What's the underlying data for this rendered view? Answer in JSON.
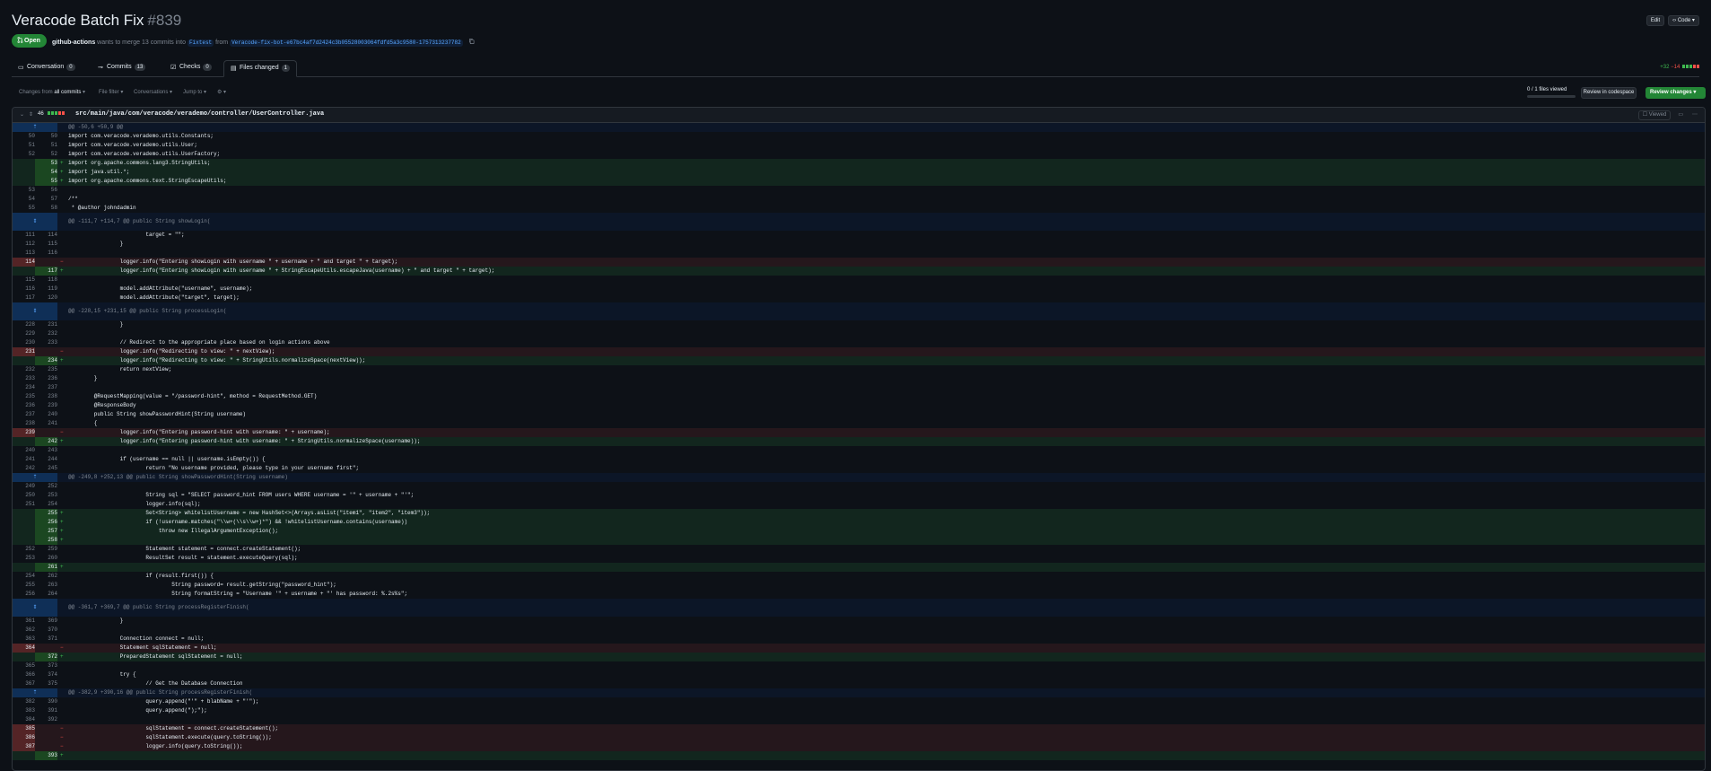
{
  "pr": {
    "title": "Veracode Batch Fix",
    "number": "#839",
    "state": "Open",
    "author": "github-actions",
    "merge_text": "wants to merge 13 commits into",
    "base_branch": "Fixtest",
    "from_text": "from",
    "head_branch": "Veracode-fix-bot-e67bc4af7d2424c3b05528003064fdfd5a3c9580-1757313237782",
    "edit_label": "Edit",
    "code_label": "Code"
  },
  "tabs": [
    {
      "label": "Conversation",
      "count": "0"
    },
    {
      "label": "Commits",
      "count": "13"
    },
    {
      "label": "Checks",
      "count": "0"
    },
    {
      "label": "Files changed",
      "count": "1"
    }
  ],
  "diffstat": {
    "additions": "+32",
    "deletions": "−14"
  },
  "toolbar": {
    "changes_from": "Changes from",
    "all_commits": "all commits",
    "file_filter": "File filter",
    "conversations": "Conversations",
    "jump_to": "Jump to",
    "files_viewed": "0 / 1 files viewed",
    "review_codespace": "Review in codespace",
    "review_changes": "Review changes"
  },
  "file": {
    "changes": "46",
    "path": "src/main/java/com/veracode/verademo/controller/UserController.java",
    "viewed_label": "Viewed"
  },
  "diff_lines": [
    {
      "t": "hunk",
      "o": "",
      "n": "",
      "c": "@@ -50,6 +50,9 @@"
    },
    {
      "t": "ctx",
      "o": "50",
      "n": "50",
      "c": "import com.veracode.verademo.utils.Constants;"
    },
    {
      "t": "ctx",
      "o": "51",
      "n": "51",
      "c": "import com.veracode.verademo.utils.User;"
    },
    {
      "t": "ctx",
      "o": "52",
      "n": "52",
      "c": "import com.veracode.verademo.utils.UserFactory;"
    },
    {
      "t": "add",
      "o": "",
      "n": "53",
      "c": "import org.apache.commons.lang3.StringUtils;"
    },
    {
      "t": "add",
      "o": "",
      "n": "54",
      "c": "import java.util.*;"
    },
    {
      "t": "add",
      "o": "",
      "n": "55",
      "c": "import org.apache.commons.text.StringEscapeUtils;"
    },
    {
      "t": "ctx",
      "o": "53",
      "n": "56",
      "c": ""
    },
    {
      "t": "ctx",
      "o": "54",
      "n": "57",
      "c": "/**"
    },
    {
      "t": "ctx",
      "o": "55",
      "n": "58",
      "c": " * @author johndadmin"
    },
    {
      "t": "hunkT",
      "o": "",
      "n": "",
      "c": "@@ -111,7 +114,7 @@ public String showLogin("
    },
    {
      "t": "ctx",
      "o": "111",
      "n": "114",
      "c": "                        target = \"\";"
    },
    {
      "t": "ctx",
      "o": "112",
      "n": "115",
      "c": "                }"
    },
    {
      "t": "ctx",
      "o": "113",
      "n": "116",
      "c": ""
    },
    {
      "t": "del",
      "o": "114",
      "n": "",
      "c": "                logger.info(\"Entering showLogin with username \" + username + \" and target \" + target);"
    },
    {
      "t": "add",
      "o": "",
      "n": "117",
      "c": "                logger.info(\"Entering showLogin with username \" + StringEscapeUtils.escapeJava(username) + \" and target \" + target);"
    },
    {
      "t": "ctx",
      "o": "115",
      "n": "118",
      "c": ""
    },
    {
      "t": "ctx",
      "o": "116",
      "n": "119",
      "c": "                model.addAttribute(\"username\", username);"
    },
    {
      "t": "ctx",
      "o": "117",
      "n": "120",
      "c": "                model.addAttribute(\"target\", target);"
    },
    {
      "t": "hunkT",
      "o": "",
      "n": "",
      "c": "@@ -228,15 +231,15 @@ public String processLogin("
    },
    {
      "t": "ctx",
      "o": "228",
      "n": "231",
      "c": "                }"
    },
    {
      "t": "ctx",
      "o": "229",
      "n": "232",
      "c": ""
    },
    {
      "t": "ctx",
      "o": "230",
      "n": "233",
      "c": "                // Redirect to the appropriate place based on login actions above"
    },
    {
      "t": "del",
      "o": "231",
      "n": "",
      "c": "                logger.info(\"Redirecting to view: \" + nextView);"
    },
    {
      "t": "add",
      "o": "",
      "n": "234",
      "c": "                logger.info(\"Redirecting to view: \" + StringUtils.normalizeSpace(nextView));"
    },
    {
      "t": "ctx",
      "o": "232",
      "n": "235",
      "c": "                return nextView;"
    },
    {
      "t": "ctx",
      "o": "233",
      "n": "236",
      "c": "        }"
    },
    {
      "t": "ctx",
      "o": "234",
      "n": "237",
      "c": ""
    },
    {
      "t": "ctx",
      "o": "235",
      "n": "238",
      "c": "        @RequestMapping(value = \"/password-hint\", method = RequestMethod.GET)"
    },
    {
      "t": "ctx",
      "o": "236",
      "n": "239",
      "c": "        @ResponseBody"
    },
    {
      "t": "ctx",
      "o": "237",
      "n": "240",
      "c": "        public String showPasswordHint(String username)"
    },
    {
      "t": "ctx",
      "o": "238",
      "n": "241",
      "c": "        {"
    },
    {
      "t": "del",
      "o": "239",
      "n": "",
      "c": "                logger.info(\"Entering password-hint with username: \" + username);"
    },
    {
      "t": "add",
      "o": "",
      "n": "242",
      "c": "                logger.info(\"Entering password-hint with username: \" + StringUtils.normalizeSpace(username));"
    },
    {
      "t": "ctx",
      "o": "240",
      "n": "243",
      "c": ""
    },
    {
      "t": "ctx",
      "o": "241",
      "n": "244",
      "c": "                if (username == null || username.isEmpty()) {"
    },
    {
      "t": "ctx",
      "o": "242",
      "n": "245",
      "c": "                        return \"No username provided, please type in your username first\";"
    },
    {
      "t": "hunk",
      "o": "",
      "n": "",
      "c": "@@ -249,8 +252,13 @@ public String showPasswordHint(String username)"
    },
    {
      "t": "ctx",
      "o": "249",
      "n": "252",
      "c": ""
    },
    {
      "t": "ctx",
      "o": "250",
      "n": "253",
      "c": "                        String sql = \"SELECT password_hint FROM users WHERE username = '\" + username + \"'\";"
    },
    {
      "t": "ctx",
      "o": "251",
      "n": "254",
      "c": "                        logger.info(sql);"
    },
    {
      "t": "add",
      "o": "",
      "n": "255",
      "c": "                        Set<String> whitelistUsername = new HashSet<>(Arrays.asList(\"item1\", \"item2\", \"item3\"));"
    },
    {
      "t": "add",
      "o": "",
      "n": "256",
      "c": "                        if (!username.matches(\"\\\\w+(\\\\s\\\\w+)*\") && !whitelistUsername.contains(username))"
    },
    {
      "t": "add",
      "o": "",
      "n": "257",
      "c": "                            throw new IllegalArgumentException();"
    },
    {
      "t": "add",
      "o": "",
      "n": "258",
      "c": ""
    },
    {
      "t": "ctx",
      "o": "252",
      "n": "259",
      "c": "                        Statement statement = connect.createStatement();"
    },
    {
      "t": "ctx",
      "o": "253",
      "n": "260",
      "c": "                        ResultSet result = statement.executeQuery(sql);"
    },
    {
      "t": "add",
      "o": "",
      "n": "261",
      "c": ""
    },
    {
      "t": "ctx",
      "o": "254",
      "n": "262",
      "c": "                        if (result.first()) {"
    },
    {
      "t": "ctx",
      "o": "255",
      "n": "263",
      "c": "                                String password= result.getString(\"password_hint\");"
    },
    {
      "t": "ctx",
      "o": "256",
      "n": "264",
      "c": "                                String formatString = \"Username '\" + username + \"' has password: %.2s%s\";"
    },
    {
      "t": "hunkT",
      "o": "",
      "n": "",
      "c": "@@ -361,7 +369,7 @@ public String processRegisterFinish("
    },
    {
      "t": "ctx",
      "o": "361",
      "n": "369",
      "c": "                }"
    },
    {
      "t": "ctx",
      "o": "362",
      "n": "370",
      "c": ""
    },
    {
      "t": "ctx",
      "o": "363",
      "n": "371",
      "c": "                Connection connect = null;"
    },
    {
      "t": "del",
      "o": "364",
      "n": "",
      "c": "                Statement sqlStatement = null;"
    },
    {
      "t": "add",
      "o": "",
      "n": "372",
      "c": "                PreparedStatement sqlStatement = null;"
    },
    {
      "t": "ctx",
      "o": "365",
      "n": "373",
      "c": ""
    },
    {
      "t": "ctx",
      "o": "366",
      "n": "374",
      "c": "                try {"
    },
    {
      "t": "ctx",
      "o": "367",
      "n": "375",
      "c": "                        // Get the Database Connection"
    },
    {
      "t": "hunk",
      "o": "",
      "n": "",
      "c": "@@ -382,9 +390,16 @@ public String processRegisterFinish("
    },
    {
      "t": "ctx",
      "o": "382",
      "n": "390",
      "c": "                        query.append(\"'\" + blabName + \"'\");"
    },
    {
      "t": "ctx",
      "o": "383",
      "n": "391",
      "c": "                        query.append(\");\");"
    },
    {
      "t": "ctx",
      "o": "384",
      "n": "392",
      "c": ""
    },
    {
      "t": "del",
      "o": "385",
      "n": "",
      "c": "                        sqlStatement = connect.createStatement();"
    },
    {
      "t": "del",
      "o": "386",
      "n": "",
      "c": "                        sqlStatement.execute(query.toString());"
    },
    {
      "t": "del",
      "o": "387",
      "n": "",
      "c": "                        logger.info(query.toString());"
    },
    {
      "t": "add",
      "o": "",
      "n": "393",
      "c": ""
    }
  ]
}
